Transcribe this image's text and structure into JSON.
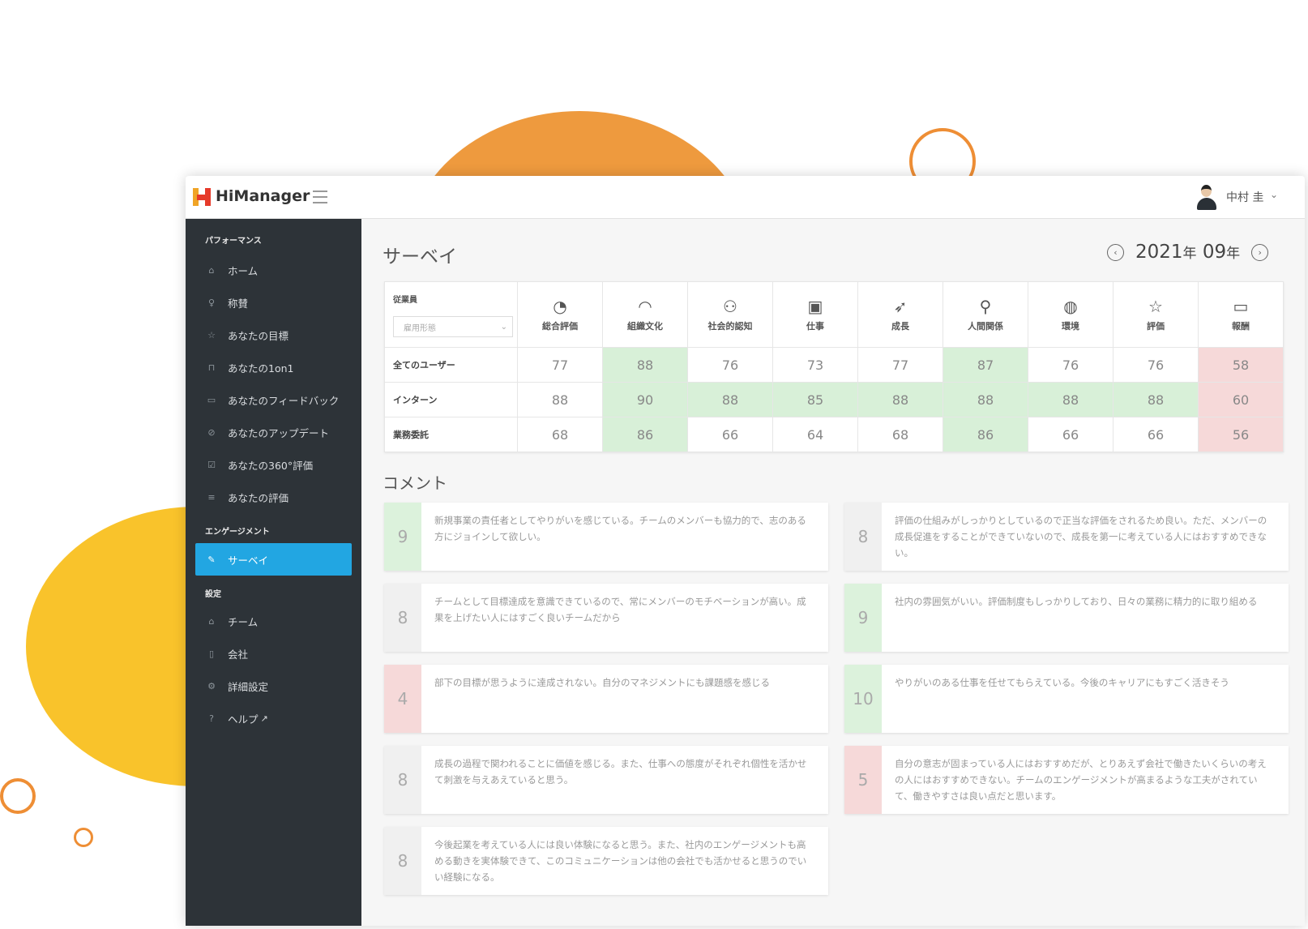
{
  "app": {
    "brand": "HiManager",
    "user_name": "中村 圭"
  },
  "sidebar": {
    "sections": [
      {
        "label": "パフォーマンス"
      },
      {
        "label": "エンゲージメント"
      },
      {
        "label": "設定"
      }
    ],
    "items": [
      {
        "label": "ホーム",
        "icon": "home-icon"
      },
      {
        "label": "称賛",
        "icon": "lightbulb-icon"
      },
      {
        "label": "あなたの目標",
        "icon": "star-icon"
      },
      {
        "label": "あなたの1on1",
        "icon": "lock-icon"
      },
      {
        "label": "あなたのフィードバック",
        "icon": "chat-bubble-icon"
      },
      {
        "label": "あなたのアップデート",
        "icon": "check-circle-icon"
      },
      {
        "label": "あなたの360°評価",
        "icon": "checkbox-icon"
      },
      {
        "label": "あなたの評価",
        "icon": "list-icon"
      },
      {
        "label": "サーベイ",
        "icon": "edit-icon",
        "active": true
      },
      {
        "label": "チーム",
        "icon": "home-icon"
      },
      {
        "label": "会社",
        "icon": "building-icon"
      },
      {
        "label": "詳細設定",
        "icon": "gears-icon"
      },
      {
        "label": "ヘルプ",
        "icon": "question-circle-icon"
      }
    ]
  },
  "page": {
    "title": "サーベイ",
    "date_year": "2021",
    "date_year_suffix": "年",
    "date_month": "09",
    "date_month_suffix": "年"
  },
  "survey": {
    "employee_label": "従業員",
    "filter_placeholder": "雇用形態",
    "columns": [
      {
        "label": "総合評価",
        "icon": "pie-chart-icon"
      },
      {
        "label": "組織文化",
        "icon": "gauge-icon"
      },
      {
        "label": "社会的認知",
        "icon": "users-icon"
      },
      {
        "label": "仕事",
        "icon": "briefcase-icon"
      },
      {
        "label": "成長",
        "icon": "rocket-icon"
      },
      {
        "label": "人間関係",
        "icon": "user-icon"
      },
      {
        "label": "環境",
        "icon": "globe-icon"
      },
      {
        "label": "評価",
        "icon": "star-icon"
      },
      {
        "label": "報酬",
        "icon": "wallet-icon"
      }
    ],
    "rows": [
      {
        "label": "全てのユーザー",
        "values": [
          77,
          88,
          76,
          73,
          77,
          87,
          76,
          76,
          58
        ],
        "status": [
          "n",
          "g",
          "n",
          "n",
          "n",
          "g",
          "n",
          "n",
          "r"
        ]
      },
      {
        "label": "インターン",
        "values": [
          88,
          90,
          88,
          85,
          88,
          88,
          88,
          88,
          60
        ],
        "status": [
          "n",
          "g",
          "g",
          "g",
          "g",
          "g",
          "g",
          "g",
          "r"
        ]
      },
      {
        "label": "業務委託",
        "values": [
          68,
          86,
          66,
          64,
          68,
          86,
          66,
          66,
          56
        ],
        "status": [
          "n",
          "g",
          "n",
          "n",
          "n",
          "g",
          "n",
          "n",
          "r"
        ]
      }
    ]
  },
  "comments": {
    "title": "コメント",
    "items": [
      {
        "score": "9",
        "status": "g",
        "text": "新規事業の責任者としてやりがいを感じている。チームのメンバーも協力的で、志のある方にジョインして欲しい。"
      },
      {
        "score": "8",
        "status": "n",
        "text": "評価の仕組みがしっかりとしているので正当な評価をされるため良い。ただ、メンバーの成長促進をすることができていないので、成長を第一に考えている人にはおすすめできない。"
      },
      {
        "score": "8",
        "status": "n",
        "text": "チームとして目標達成を意識できているので、常にメンバーのモチベーションが高い。成果を上げたい人にはすごく良いチームだから"
      },
      {
        "score": "9",
        "status": "g",
        "text": "社内の雰囲気がいい。評価制度もしっかりしており、日々の業務に精力的に取り組める"
      },
      {
        "score": "4",
        "status": "r",
        "text": "部下の目標が思うように達成されない。自分のマネジメントにも課題感を感じる"
      },
      {
        "score": "10",
        "status": "g",
        "text": "やりがいのある仕事を任せてもらえている。今後のキャリアにもすごく活きそう"
      },
      {
        "score": "8",
        "status": "n",
        "text": "成長の過程で関われることに価値を感じる。また、仕事への態度がそれぞれ個性を活かせて刺激を与えあえていると思う。"
      },
      {
        "score": "5",
        "status": "r",
        "text": "自分の意志が固まっている人にはおすすめだが、とりあえず会社で働きたいくらいの考えの人にはおすすめできない。チームのエンゲージメントが高まるような工夫がされていて、働きやすさは良い点だと思います。"
      },
      {
        "score": "8",
        "status": "n",
        "text": "今後起業を考えている人には良い体験になると思う。また、社内のエンゲージメントも高める動きを実体験できて、このコミュニケーションは他の会社でも活かせると思うのでいい経験になる。"
      }
    ]
  }
}
